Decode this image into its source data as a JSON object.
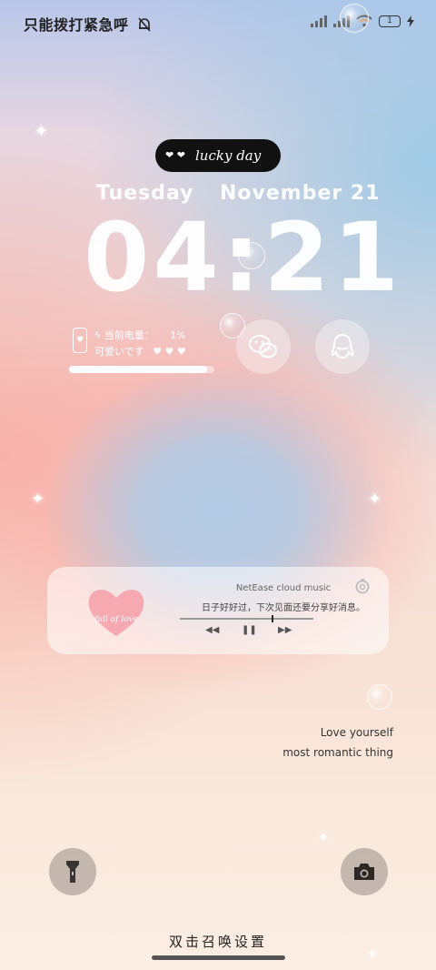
{
  "status_bar": {
    "carrier_text": "只能拨打紧急呼",
    "battery_level": "1",
    "colors": {
      "text": "#222222"
    },
    "icons": [
      "mute-bell-icon",
      "signal-icon",
      "signal-icon",
      "wifi-icon",
      "battery-icon",
      "charging-bolt-icon"
    ]
  },
  "lock": {
    "pill_text": "lucky day",
    "pill_hearts": "❤︎ ❤︎",
    "weekday": "Tuesday",
    "date": "November 21",
    "time": "04:21"
  },
  "battery_widget": {
    "label": "当前电量：",
    "percent": "1%",
    "subtitle": "可爱いです",
    "hearts": "♥ ♥ ♥",
    "level": 0.95
  },
  "shortcuts": {
    "wechat_icon": "wechat-icon",
    "qq_icon": "qq-penguin-icon"
  },
  "music": {
    "source": "NetEase cloud music",
    "lyric": "日子好好过，下次见面还要分享好消息。",
    "cover_text": "full of love",
    "prev": "◀◀",
    "pause": "❚❚",
    "next": "▶▶",
    "progress": 0.69
  },
  "quote": {
    "line1": "Love yourself",
    "line2": "most romantic thing"
  },
  "bottom": {
    "hint": "双击召唤设置"
  }
}
